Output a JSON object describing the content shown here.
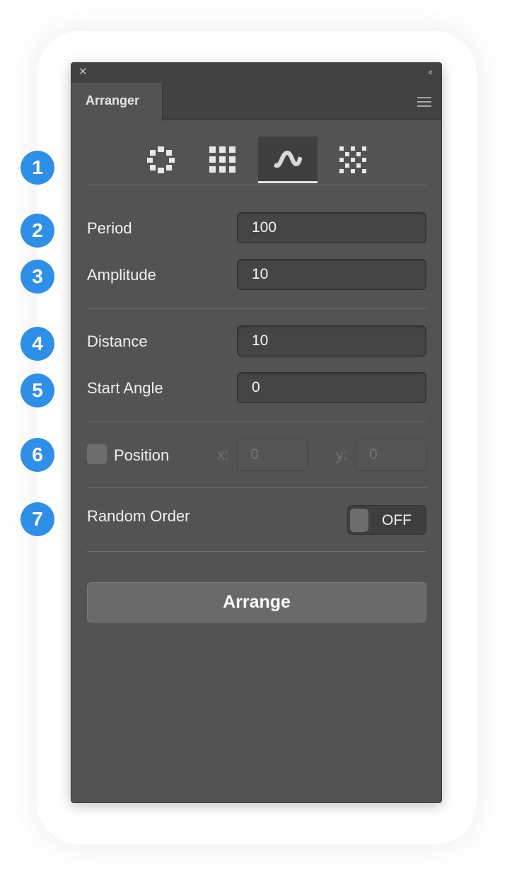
{
  "window": {
    "close_glyph": "✕",
    "collapse_glyph": "‹‹"
  },
  "panel": {
    "tab_label": "Arranger",
    "modes": [
      {
        "name": "circle-mode",
        "active": false
      },
      {
        "name": "grid-mode",
        "active": false
      },
      {
        "name": "wave-mode",
        "active": true
      },
      {
        "name": "diamond-mode",
        "active": false
      }
    ],
    "fields": {
      "period": {
        "label": "Period",
        "value": "100"
      },
      "amplitude": {
        "label": "Amplitude",
        "value": "10"
      },
      "distance": {
        "label": "Distance",
        "value": "10"
      },
      "start_angle": {
        "label": "Start Angle",
        "value": "0"
      }
    },
    "position": {
      "label": "Position",
      "x_label": "x:",
      "x_value": "0",
      "y_label": "y:",
      "y_value": "0",
      "checked": false
    },
    "random_order": {
      "label": "Random Order",
      "toggle_text": "OFF"
    },
    "arrange_button": "Arrange"
  },
  "badges": [
    "1",
    "2",
    "3",
    "4",
    "5",
    "6",
    "7"
  ],
  "colors": {
    "panel_bg": "#535353",
    "badge": "#2f8fe6"
  }
}
